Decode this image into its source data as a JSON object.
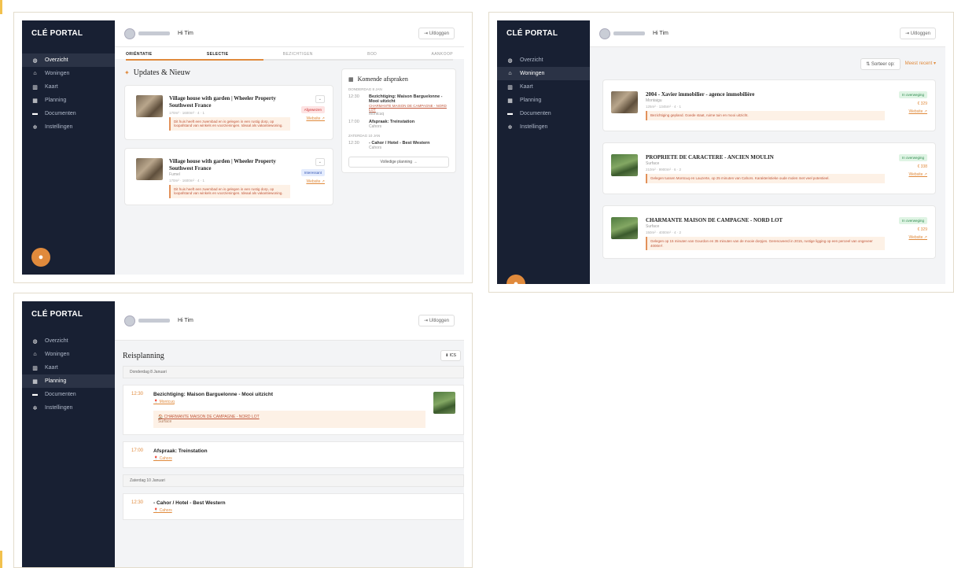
{
  "app": {
    "brand": "CLÉ PORTAL",
    "greeting": "Hi Tim",
    "logout": "⇥ Uitloggen"
  },
  "nav": [
    {
      "label": "Overzicht",
      "icon": "gauge-icon",
      "glyph": "◍"
    },
    {
      "label": "Woningen",
      "icon": "home-icon",
      "glyph": "⌂"
    },
    {
      "label": "Kaart",
      "icon": "map-icon",
      "glyph": "▥"
    },
    {
      "label": "Planning",
      "icon": "calendar-icon",
      "glyph": "▦"
    },
    {
      "label": "Documenten",
      "icon": "folder-icon",
      "glyph": "▬"
    },
    {
      "label": "Instellingen",
      "icon": "gear-icon",
      "glyph": "✲"
    }
  ],
  "colors": {
    "sidebar": "#182033",
    "accent": "#e08a3c",
    "note_bg": "#fdf1e6"
  },
  "overview": {
    "steps": [
      "ORIËNTATIE",
      "SELECTIE",
      "BEZICHTIGEN",
      "BOD",
      "AANKOOP"
    ],
    "progress": 0.42,
    "updates_title": "Updates & Nieuw",
    "updates": [
      {
        "title": "Village house with garden | Wheeler Property Southwest France",
        "subtitle": "",
        "meta": "170m² · 1600m² · 4 · 1",
        "note": "Dit huis heeft een zwembad en is gelegen in een rustig dorp, op loopafstand van winkels en voorzieningen. Ideaal als vakantiewoning.",
        "badge": "Afgewezen",
        "badge_type": "red",
        "link": "Website ↗"
      },
      {
        "title": "Village house with garden | Wheeler Property Southwest France",
        "subtitle": "Fumel",
        "meta": "170m² · 1600m² · 4 · 1",
        "note": "Dit huis heeft een zwembad en is gelegen in een rustig dorp, op loopafstand van winkels en voorzieningen. Ideaal als vakantiewoning.",
        "badge": "Interessant",
        "badge_type": "blue",
        "link": "Website ↗"
      }
    ],
    "appointments_title": "Komende afspraken",
    "appointments": [
      {
        "day": "DONDERDAG 8 JAN",
        "time": "12:30",
        "title": "Bezichtiging: Maison Barguelonne - Mooi uitzicht",
        "sub": "CHARMANTE MAISON DE CAMPAGNE - NORD LOT",
        "place": "Montcuq"
      },
      {
        "day": "",
        "time": "17:00",
        "title": "Afspraak: Treinstation",
        "sub": "",
        "place": "Cahors"
      },
      {
        "day": "ZATERDAG 10 JAN",
        "time": "12:30",
        "title": "- Cahor / Hotel - Best Western",
        "sub": "",
        "place": "Cahors"
      }
    ],
    "full_planning": "Volledige planning →"
  },
  "woningen": {
    "sort_label": "⇅ Sorteer op:",
    "sort_value": "Meest recent ▾",
    "items": [
      {
        "title": "2004 - Xavier immobilier - agence immobilière",
        "subtitle": "Montaigu",
        "meta": "125m² · 1345m² · 4 · 1",
        "note": "Bezichtiging gepland. Goede staat, ruime tuin en mooi uitzicht.",
        "badge": "In overweging",
        "price": "€ 329",
        "link": "Website ↗",
        "thumb": "brown"
      },
      {
        "title": "PROPRIETE DE CARACTERE - ANCIEN MOULIN",
        "subtitle": "Surface",
        "meta": "210m² · 9900m² · 6 · 2",
        "note": "Gelegen tussen Montcuq en Lauzerte, op 25 minuten van Cahors. Karakteristieke oude molen met veel potentieel.",
        "badge": "In overweging",
        "price": "€ 338",
        "link": "Website ↗",
        "thumb": "green"
      },
      {
        "title": "CHARMANTE MAISON DE CAMPAGNE - NORD LOT",
        "subtitle": "Surface",
        "meta": "150m² · 4000m² · 4 · 2",
        "note": "Gelegen op 15 minuten van Gourdon en 35 minuten van de mooie dorpjes. Gerenoveerd in 2015, rustige ligging op een perceel van ongeveer 4000m².",
        "badge": "In overweging",
        "price": "€ 329",
        "link": "Website ↗",
        "thumb": "green"
      }
    ]
  },
  "planning": {
    "title": "Reisplanning",
    "ics_button": "⬇ ICS",
    "days": [
      {
        "label": "Donderdag 8 Januari",
        "items": [
          {
            "time": "12:30",
            "title": "Bezichtiging: Maison Barguelonne - Mooi uitzicht",
            "location": "📍 Montcuq",
            "linked": "🏠 CHARMANTE MAISON DE CAMPAGNE - NORD LOT",
            "linked_sub": "Surface"
          },
          {
            "time": "17:00",
            "title": "Afspraak: Treinstation",
            "location": "📍 Cahors",
            "linked": "",
            "linked_sub": ""
          }
        ]
      },
      {
        "label": "Zaterdag 10 Januari",
        "items": [
          {
            "time": "12:30",
            "title": "- Cahor / Hotel - Best Western",
            "location": "📍 Cahors",
            "linked": "",
            "linked_sub": ""
          }
        ]
      }
    ]
  }
}
